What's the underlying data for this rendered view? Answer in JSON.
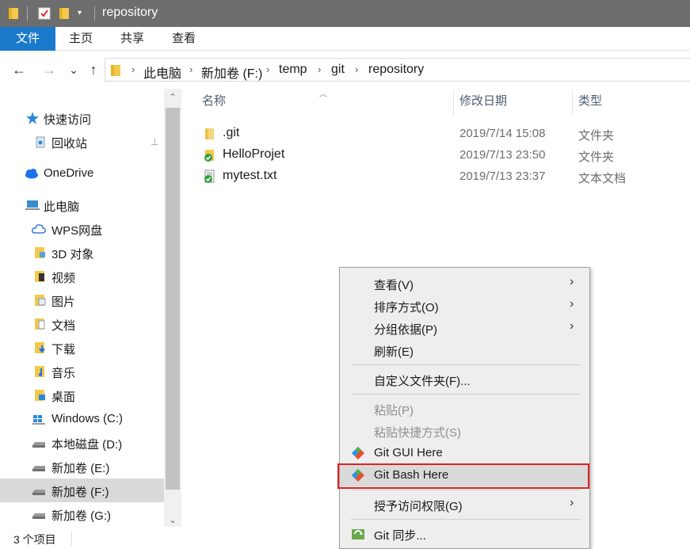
{
  "titlebar": {
    "title": "repository",
    "quick_access_arrow": "▾"
  },
  "ribbon": {
    "tabs": [
      "文件",
      "主页",
      "共享",
      "查看"
    ]
  },
  "address": {
    "back": "←",
    "forward": "→",
    "recent": "⌄",
    "up": "↑",
    "crumbs": [
      "此电脑",
      "新加卷 (F:)",
      "temp",
      "git",
      "repository"
    ],
    "separator": "›"
  },
  "sidebar": {
    "items": [
      {
        "label": "快速访问",
        "icon": "star-icon"
      },
      {
        "label": "回收站",
        "icon": "recycle-bin-icon"
      },
      {
        "label": "OneDrive",
        "icon": "cloud-icon"
      },
      {
        "label": "此电脑",
        "icon": "computer-icon"
      },
      {
        "label": "WPS网盘",
        "icon": "wps-cloud-icon"
      },
      {
        "label": "3D 对象",
        "icon": "3d-objects-icon"
      },
      {
        "label": "视频",
        "icon": "video-icon"
      },
      {
        "label": "图片",
        "icon": "pictures-icon"
      },
      {
        "label": "文档",
        "icon": "documents-icon"
      },
      {
        "label": "下载",
        "icon": "downloads-icon"
      },
      {
        "label": "音乐",
        "icon": "music-icon"
      },
      {
        "label": "桌面",
        "icon": "desktop-icon"
      },
      {
        "label": "Windows (C:)",
        "icon": "windows-drive-icon"
      },
      {
        "label": "本地磁盘 (D:)",
        "icon": "drive-icon"
      },
      {
        "label": "新加卷 (E:)",
        "icon": "drive-icon"
      },
      {
        "label": "新加卷 (F:)",
        "icon": "drive-icon"
      },
      {
        "label": "新加卷 (G:)",
        "icon": "drive-icon"
      }
    ],
    "pin": "📌"
  },
  "columns": {
    "name": "名称",
    "date": "修改日期",
    "type": "类型"
  },
  "files": [
    {
      "name": ".git",
      "date": "2019/7/14 15:08",
      "type": "文件夹",
      "icon": "folder-icon"
    },
    {
      "name": "HelloProjet",
      "date": "2019/7/13 23:50",
      "type": "文件夹",
      "icon": "git-folder-icon"
    },
    {
      "name": "mytest.txt",
      "date": "2019/7/13 23:37",
      "type": "文本文档",
      "icon": "git-file-icon"
    }
  ],
  "status": {
    "count": "3 个项目"
  },
  "context_menu": {
    "items": [
      {
        "label": "查看(V)",
        "submenu": true
      },
      {
        "label": "排序方式(O)",
        "submenu": true
      },
      {
        "label": "分组依据(P)",
        "submenu": true
      },
      {
        "label": "刷新(E)"
      },
      {
        "label": "自定义文件夹(F)..."
      },
      {
        "label": "粘贴(P)",
        "disabled": true
      },
      {
        "label": "粘贴快捷方式(S)",
        "disabled": true
      },
      {
        "label": "Git GUI Here",
        "icon": "git-gui-icon"
      },
      {
        "label": "Git Bash Here",
        "icon": "git-bash-icon",
        "highlighted": true
      },
      {
        "label": "授予访问权限(G)",
        "submenu": true
      },
      {
        "label": "Git 同步...",
        "icon": "git-sync-icon"
      }
    ],
    "submenu_glyph": "›"
  },
  "colors": {
    "accent": "#1979ca",
    "titlebar": "#6d6d6d",
    "highlight_box": "#e02020",
    "folder": "#f2c94c"
  }
}
